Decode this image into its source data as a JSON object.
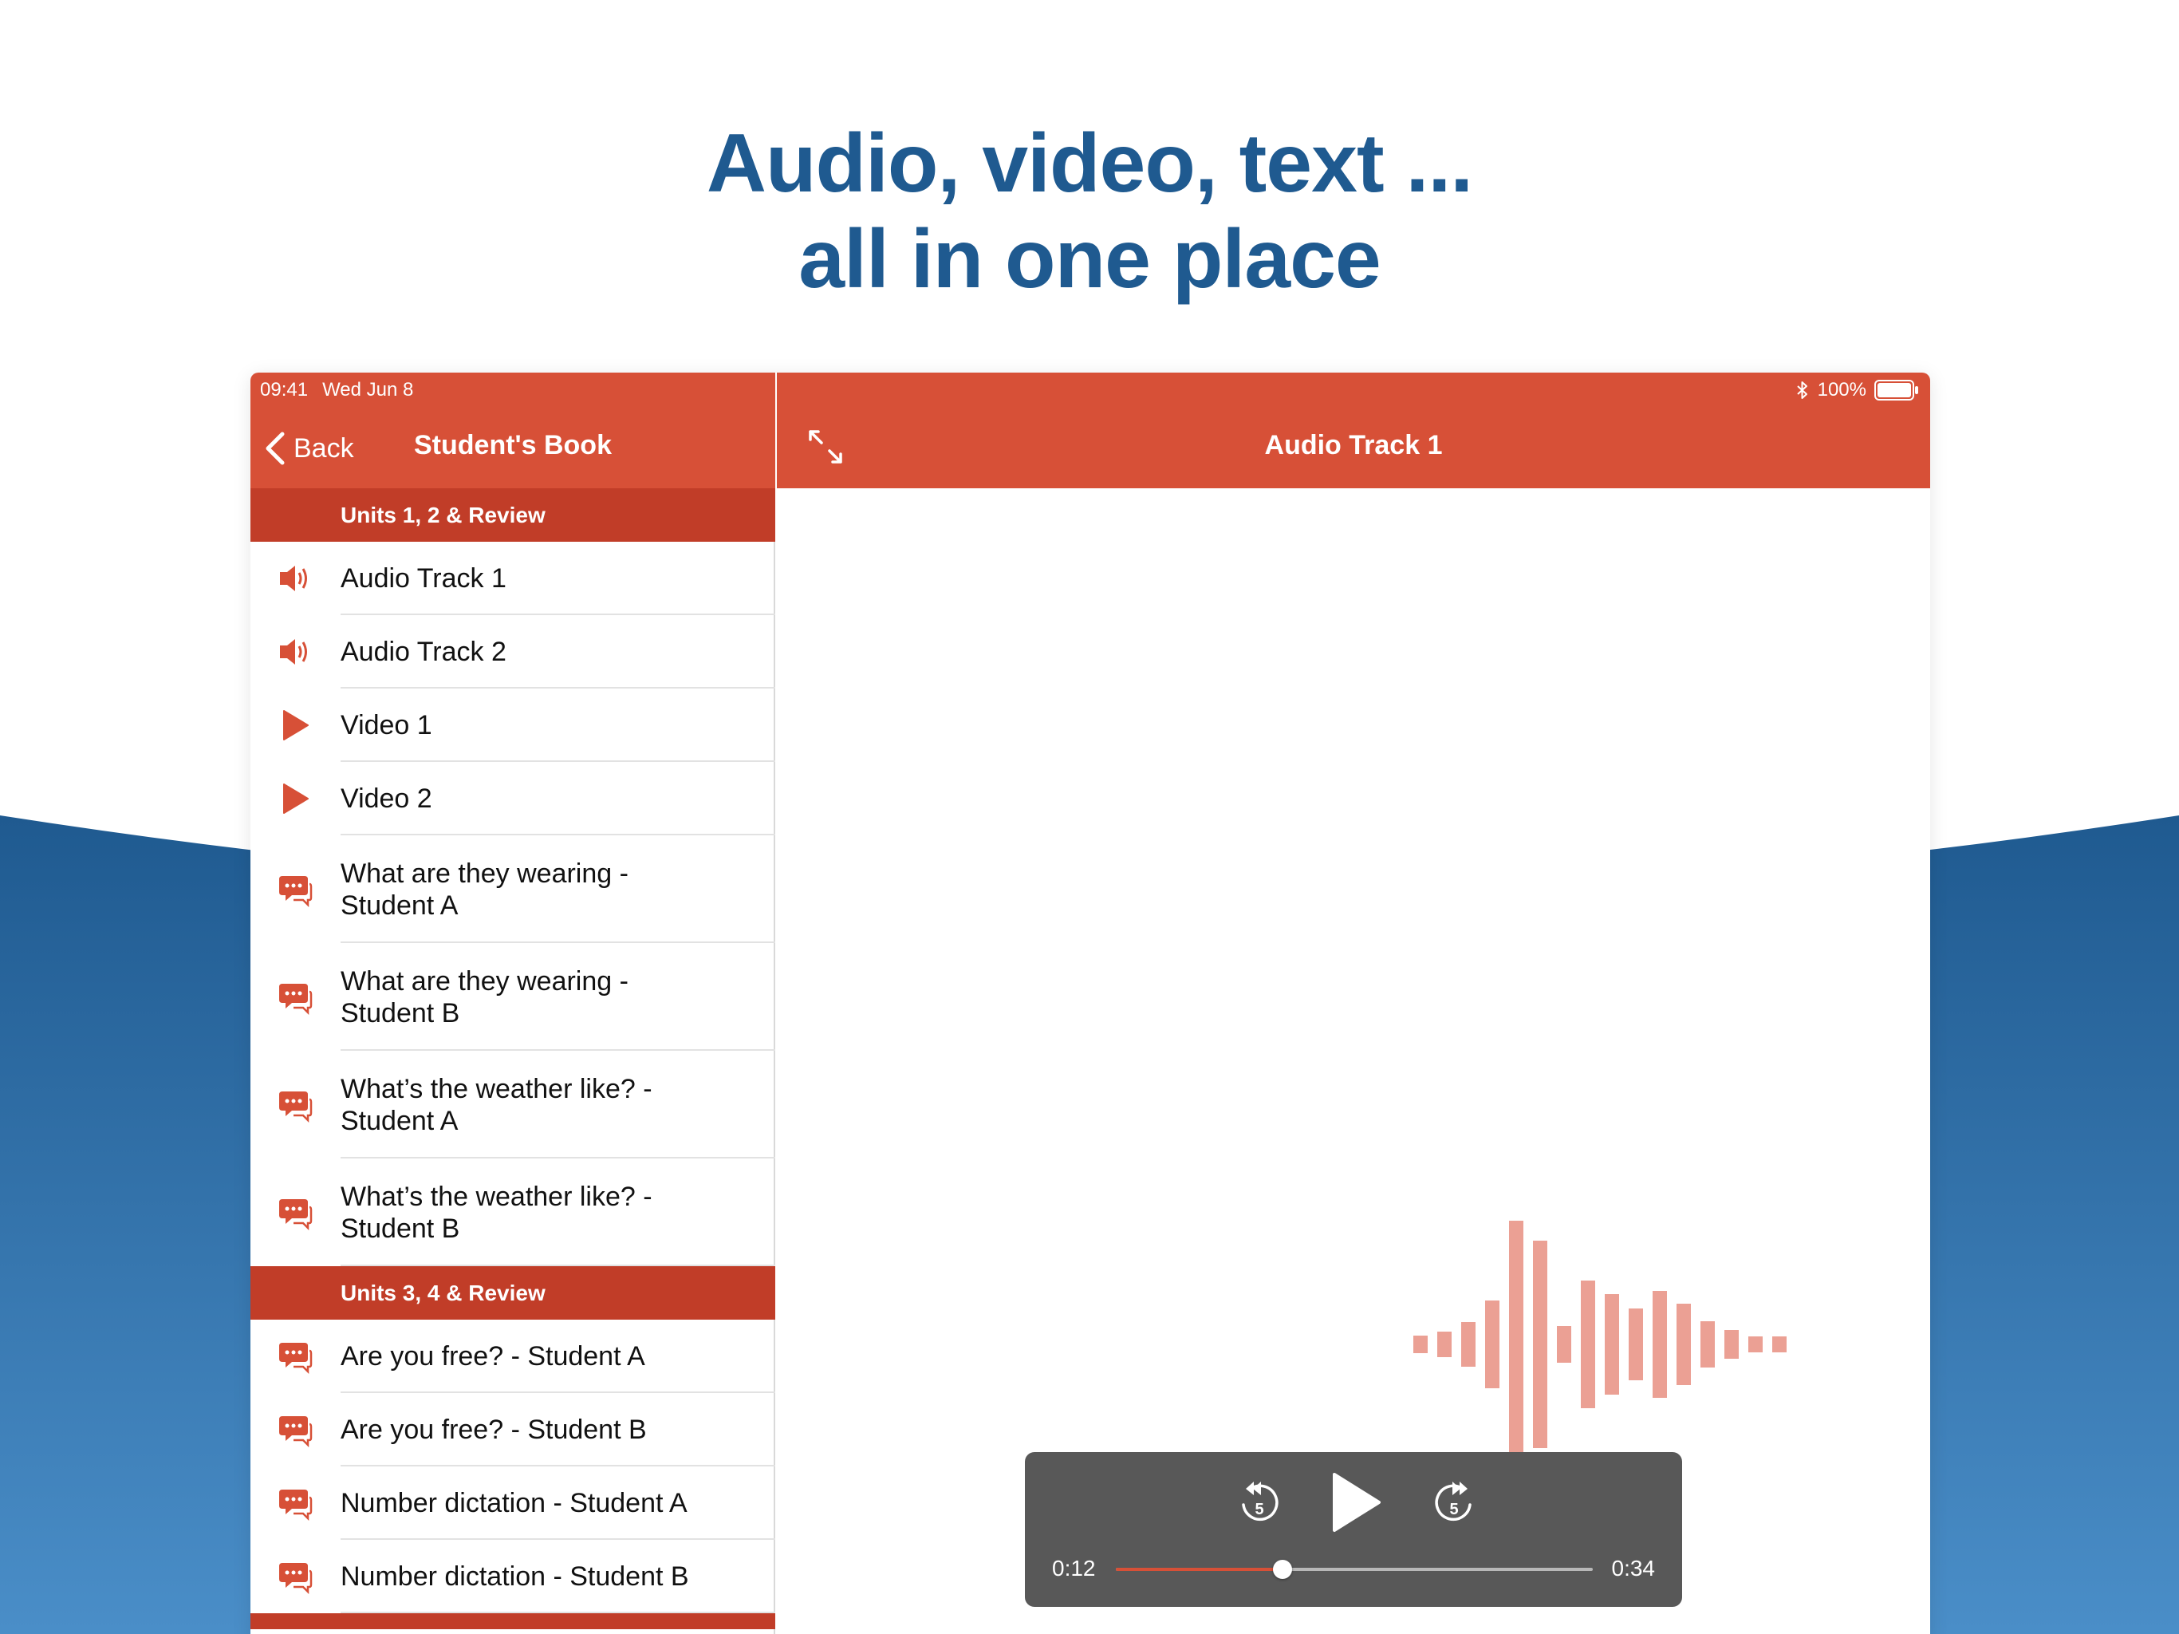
{
  "headline": {
    "line1": "Audio, video, text ...",
    "line2": "all in one place"
  },
  "colors": {
    "headline_blue": "#1f5a90",
    "bar_orange": "#d75037",
    "section_red": "#c13d28",
    "waveform_pink": "#eba094",
    "player_gray": "#585858",
    "background_wave_top": "#1f5a90",
    "background_wave_bottom": "#4a8ec8"
  },
  "status_bar": {
    "time": "09:41",
    "date": "Wed Jun 8",
    "battery": "100%",
    "battery_level": 1.0,
    "bluetooth_icon": "bluetooth-icon"
  },
  "master": {
    "back_label": "Back",
    "title": "Student's Book",
    "sections": [
      {
        "header": "Units 1, 2 & Review",
        "items": [
          {
            "icon": "speaker-icon",
            "label": "Audio Track 1"
          },
          {
            "icon": "speaker-icon",
            "label": "Audio Track 2"
          },
          {
            "icon": "play-icon",
            "label": "Video 1"
          },
          {
            "icon": "play-icon",
            "label": "Video 2"
          },
          {
            "icon": "chat-icon",
            "line1": "What are they wearing -",
            "line2": "Student A"
          },
          {
            "icon": "chat-icon",
            "line1": "What are they wearing -",
            "line2": "Student B"
          },
          {
            "icon": "chat-icon",
            "line1": "What’s the weather like? -",
            "line2": "Student A"
          },
          {
            "icon": "chat-icon",
            "line1": "What’s the weather like? -",
            "line2": "Student B"
          }
        ]
      },
      {
        "header": "Units 3, 4 & Review",
        "items": [
          {
            "icon": "chat-icon",
            "label": "Are you free? - Student A"
          },
          {
            "icon": "chat-icon",
            "label": "Are you free? - Student B"
          },
          {
            "icon": "chat-icon",
            "label": "Number dictation - Student A"
          },
          {
            "icon": "chat-icon",
            "label": "Number dictation - Student B"
          }
        ]
      }
    ]
  },
  "detail": {
    "title": "Audio Track 1",
    "expand_icon": "expand-icon",
    "player": {
      "current_time": "0:12",
      "duration": "0:34",
      "progress": 0.35,
      "skip_seconds_label": "5",
      "skip_back_icon": "skip-back-5-icon",
      "play_icon": "play-icon",
      "skip_forward_icon": "skip-forward-5-icon"
    }
  }
}
